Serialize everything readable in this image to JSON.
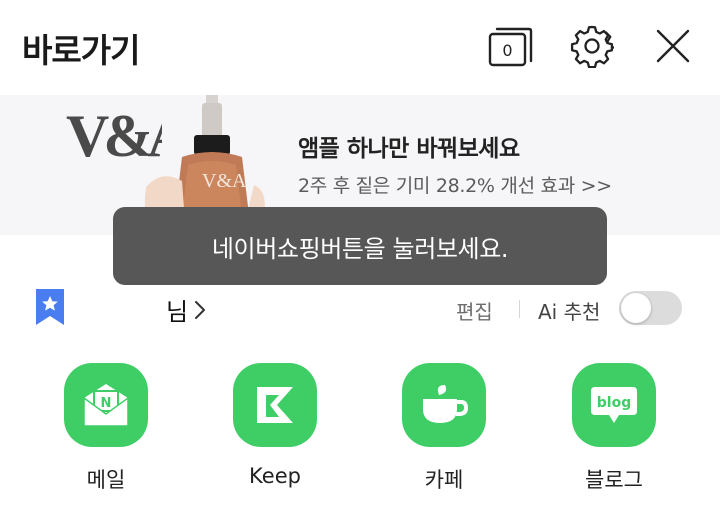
{
  "header": {
    "title": "바로가기",
    "tab_count": "0",
    "icons": [
      "tabs-icon",
      "gear-icon",
      "close-icon"
    ]
  },
  "banner": {
    "brand_logo": "V&A",
    "title": "앰플 하나만 바꿔보세요",
    "subtitle": "2주 후 짙은 기미 28.2% 개선 효과 >>"
  },
  "toast": {
    "message": "네이버쇼핑버튼을 눌러보세요."
  },
  "section": {
    "user_suffix": "님",
    "edit_label": "편집",
    "ai_label": "Ai 추천",
    "ai_enabled": false
  },
  "apps": [
    {
      "label": "메일",
      "icon": "mail-icon"
    },
    {
      "label": "Keep",
      "icon": "keep-icon"
    },
    {
      "label": "카페",
      "icon": "cafe-icon"
    },
    {
      "label": "블로그",
      "icon": "blog-icon"
    }
  ],
  "colors": {
    "app_green": "#3ece65",
    "toast_bg": "#575757",
    "bookmark_blue": "#4a7ef0",
    "banner_bg": "#f6f6f8"
  }
}
